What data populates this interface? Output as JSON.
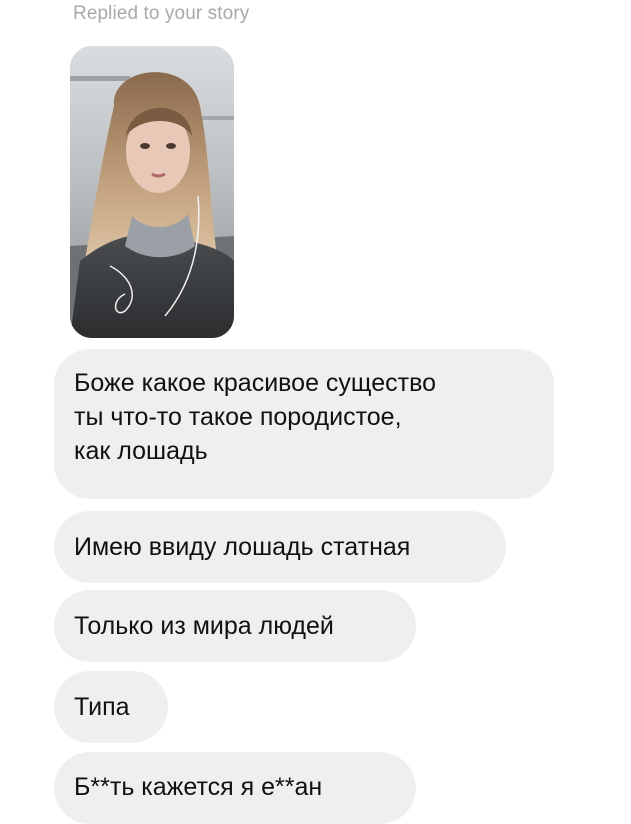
{
  "story_reply": {
    "label": "Replied to your story"
  },
  "messages": [
    {
      "lines": [
        "Боже какое красивое существо",
        "ты что-то такое породистое,",
        "как лошадь"
      ]
    },
    {
      "text": "Имею ввиду лошадь статная"
    },
    {
      "text": "Только из мира людей"
    },
    {
      "text": "Типа"
    },
    {
      "text": "Б**ть кажется я е**ан"
    }
  ],
  "colors": {
    "bubble_background": "#efefef",
    "message_text": "#111111",
    "label_text": "#a9a9a9"
  }
}
